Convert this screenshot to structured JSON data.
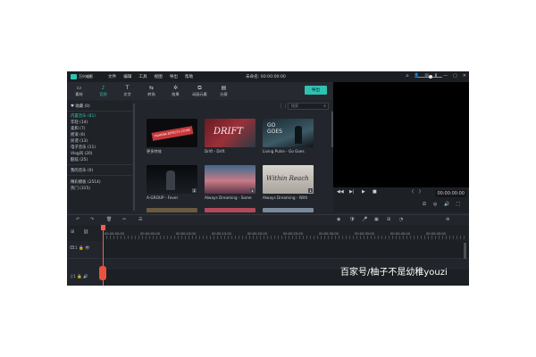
{
  "app": {
    "logo_text": "万兴喵影",
    "menu": [
      "文件",
      "编辑",
      "工具",
      "视图",
      "导出",
      "帮助"
    ],
    "doc_title": "未命名: 00:00:00:00",
    "window_icons": [
      "⌂",
      "👤",
      "✉",
      "⬇",
      "—",
      "▢",
      "✕"
    ]
  },
  "toolbar": {
    "items": [
      {
        "icon": "▭",
        "label": "素材"
      },
      {
        "icon": "♪",
        "label": "音频"
      },
      {
        "icon": "T",
        "label": "文字"
      },
      {
        "icon": "⇆",
        "label": "转场"
      },
      {
        "icon": "✲",
        "label": "效果"
      },
      {
        "icon": "⧉",
        "label": "动画元素"
      },
      {
        "icon": "▤",
        "label": "分屏"
      }
    ],
    "active_index": 1,
    "export_label": "导出"
  },
  "sidebar": {
    "favorites": "♥ 收藏 (0)",
    "items": [
      "内置音乐 (81)",
      "年轻 (14)",
      "柔和 (7)",
      "摇滚 (6)",
      "民谣 (13)",
      "电子音乐 (11)",
      "Vlog风 (20)",
      "酷炫 (25)"
    ],
    "active_index": 0,
    "my_music": "我的音乐 (0)",
    "filmstock": "精彩模板 (2514)",
    "hot": "热门 (315)"
  },
  "media": {
    "search_placeholder": "搜索",
    "tiles": [
      {
        "label": "更多特效",
        "thumb_text": "FILMORA EFFECTS STORE",
        "download": false
      },
      {
        "label": "Drift - Drift",
        "thumb_text": "DRIFT",
        "download": false
      },
      {
        "label": "Living Pulse - Go Goes",
        "thumb_text": "GO GOES",
        "download": false
      },
      {
        "label": "A-GROUP - Fever",
        "thumb_text": "",
        "download": true
      },
      {
        "label": "Always Dreaming - Same",
        "thumb_text": "",
        "download": true
      },
      {
        "label": "Always Dreaming - With",
        "thumb_text": "Within Reach",
        "download": true
      }
    ]
  },
  "preview": {
    "controls": [
      "◀◀",
      "▶|",
      "▶",
      "■",
      "⟨",
      "⟩"
    ],
    "timecode": "00:00:00:00",
    "extra_icons": [
      "⎚",
      "◎",
      "🔊",
      "⛶"
    ]
  },
  "timeline": {
    "tool_icons": [
      "↶",
      "↷",
      "🗑",
      "✂",
      "☰"
    ],
    "right_icons": [
      "◉",
      "🛡",
      "🎤",
      "▣",
      "⊞",
      "◔"
    ],
    "zoom_plus": "⊕",
    "ruler_labels": [
      "00:00:00:00",
      "00:00:05:00",
      "00:00:10:00",
      "00:00:15:00",
      "00:00:20:00",
      "00:00:25:00",
      "00:00:30:00",
      "00:00:35:00",
      "00:00:40:00",
      "00:00:45:00"
    ],
    "tracks": [
      {
        "head": "🎞1 🔒 👁"
      },
      {
        "head": "♫1 🔒 🔊"
      }
    ]
  },
  "watermark": "百家号/柚子不是幼稚youzi",
  "colors": {
    "accent": "#2fc1b2",
    "playhead": "#ff5a4e"
  }
}
